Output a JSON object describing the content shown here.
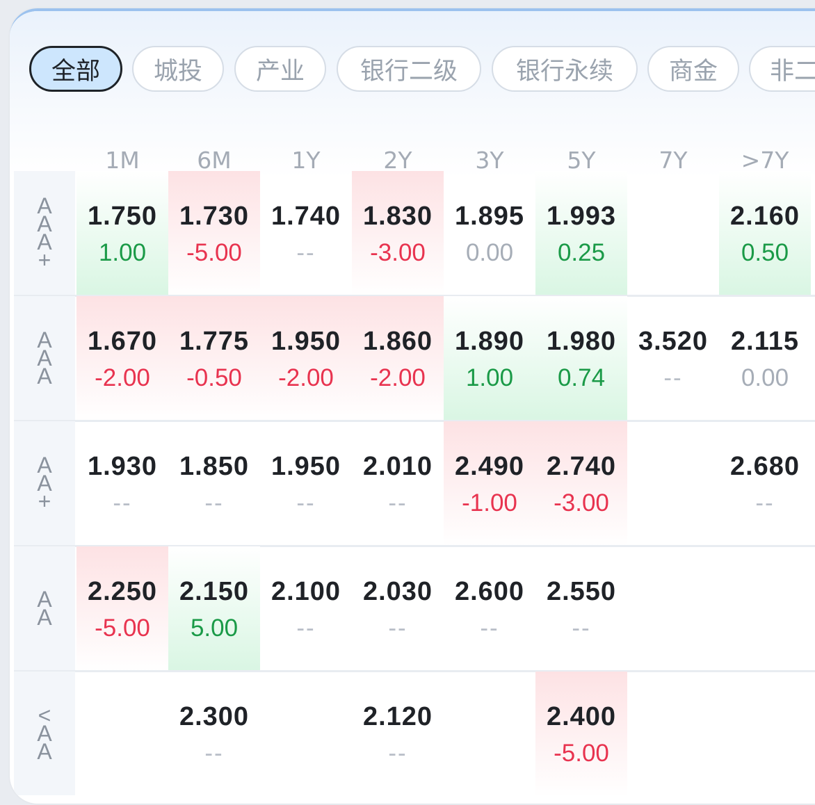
{
  "tabs": [
    {
      "label": "全部",
      "active": true
    },
    {
      "label": "城投",
      "active": false
    },
    {
      "label": "产业",
      "active": false
    },
    {
      "label": "银行二级",
      "active": false
    },
    {
      "label": "银行永续",
      "active": false
    },
    {
      "label": "商金",
      "active": false
    },
    {
      "label": "非二",
      "active": false
    }
  ],
  "columns": [
    "1M",
    "6M",
    "1Y",
    "2Y",
    "3Y",
    "5Y",
    "7Y",
    ">7Y"
  ],
  "rows": [
    {
      "rating": "AAA+",
      "cells": [
        {
          "value": "1.750",
          "change": "1.00",
          "trend": "up"
        },
        {
          "value": "1.730",
          "change": "-5.00",
          "trend": "down"
        },
        {
          "value": "1.740",
          "change": "--",
          "trend": "none"
        },
        {
          "value": "1.830",
          "change": "-3.00",
          "trend": "down"
        },
        {
          "value": "1.895",
          "change": "0.00",
          "trend": "flat"
        },
        {
          "value": "1.993",
          "change": "0.25",
          "trend": "up"
        },
        null,
        {
          "value": "2.160",
          "change": "0.50",
          "trend": "up"
        }
      ]
    },
    {
      "rating": "AAA",
      "cells": [
        {
          "value": "1.670",
          "change": "-2.00",
          "trend": "down"
        },
        {
          "value": "1.775",
          "change": "-0.50",
          "trend": "down"
        },
        {
          "value": "1.950",
          "change": "-2.00",
          "trend": "down"
        },
        {
          "value": "1.860",
          "change": "-2.00",
          "trend": "down"
        },
        {
          "value": "1.890",
          "change": "1.00",
          "trend": "up"
        },
        {
          "value": "1.980",
          "change": "0.74",
          "trend": "up"
        },
        {
          "value": "3.520",
          "change": "--",
          "trend": "none"
        },
        {
          "value": "2.115",
          "change": "0.00",
          "trend": "flat"
        }
      ]
    },
    {
      "rating": "AA+",
      "cells": [
        {
          "value": "1.930",
          "change": "--",
          "trend": "none"
        },
        {
          "value": "1.850",
          "change": "--",
          "trend": "none"
        },
        {
          "value": "1.950",
          "change": "--",
          "trend": "none"
        },
        {
          "value": "2.010",
          "change": "--",
          "trend": "none"
        },
        {
          "value": "2.490",
          "change": "-1.00",
          "trend": "down"
        },
        {
          "value": "2.740",
          "change": "-3.00",
          "trend": "down"
        },
        null,
        {
          "value": "2.680",
          "change": "--",
          "trend": "none"
        }
      ]
    },
    {
      "rating": "AA",
      "cells": [
        {
          "value": "2.250",
          "change": "-5.00",
          "trend": "down"
        },
        {
          "value": "2.150",
          "change": "5.00",
          "trend": "up"
        },
        {
          "value": "2.100",
          "change": "--",
          "trend": "none"
        },
        {
          "value": "2.030",
          "change": "--",
          "trend": "none"
        },
        {
          "value": "2.600",
          "change": "--",
          "trend": "none"
        },
        {
          "value": "2.550",
          "change": "--",
          "trend": "none"
        },
        null,
        null
      ]
    },
    {
      "rating": "<AA",
      "cells": [
        null,
        {
          "value": "2.300",
          "change": "--",
          "trend": "none"
        },
        null,
        {
          "value": "2.120",
          "change": "--",
          "trend": "none"
        },
        null,
        {
          "value": "2.400",
          "change": "-5.00",
          "trend": "down"
        },
        null,
        null
      ]
    }
  ],
  "colors": {
    "up": "#1a9a47",
    "down": "#e8334f",
    "flat": "#a6adb7",
    "active_tab_bg": "#cde6fd",
    "up_bg": "#d9f6e3",
    "down_bg": "#fde2e4"
  }
}
